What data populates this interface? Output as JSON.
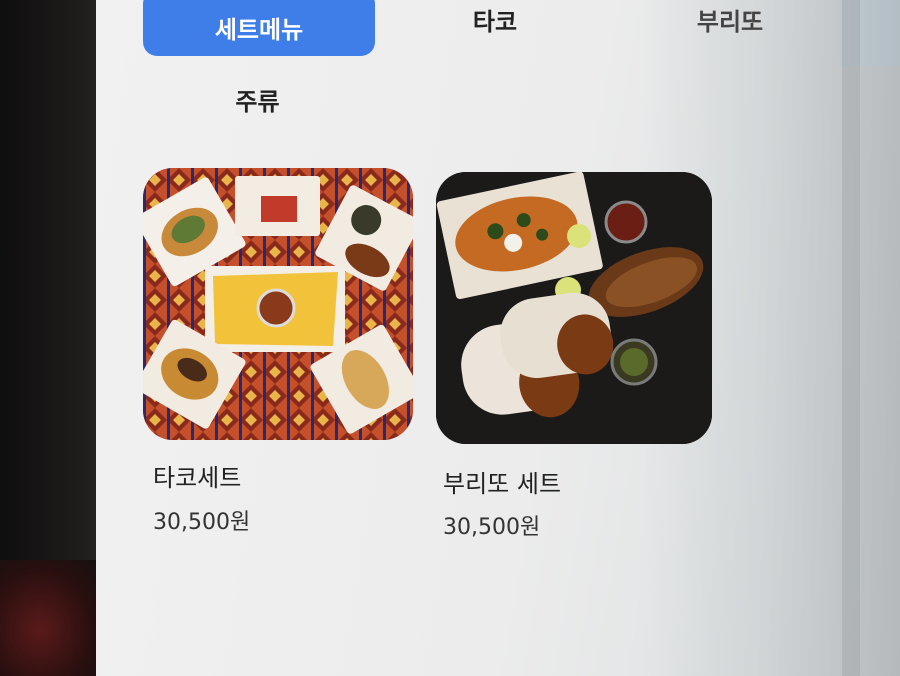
{
  "tabs": [
    {
      "label": "세트메뉴",
      "active": true
    },
    {
      "label": "타코",
      "active": false
    },
    {
      "label": "부리또",
      "active": false
    },
    {
      "label": "주류",
      "active": false
    }
  ],
  "menu_items": [
    {
      "name": "타코세트",
      "price": "30,500원",
      "image_icon": "taco-set-photo"
    },
    {
      "name": "부리또 세트",
      "price": "30,500원",
      "image_icon": "burrito-set-photo"
    }
  ],
  "colors": {
    "accent": "#3f7ee8",
    "text": "#222222"
  }
}
